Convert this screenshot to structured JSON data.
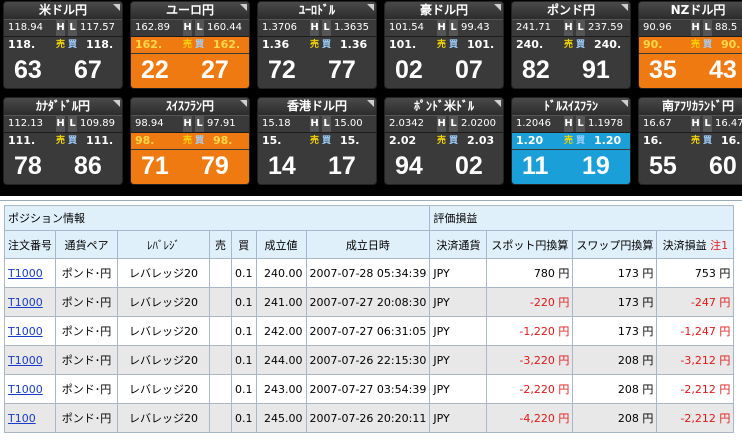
{
  "rates": [
    {
      "name": "米ドル円",
      "high": "118.94",
      "low": "117.57",
      "bid_prefix": "118.",
      "ask_prefix": "118.",
      "bid_big": "63",
      "ask_big": "67",
      "style": "dark"
    },
    {
      "name": "ユーロ円",
      "high": "162.89",
      "low": "160.44",
      "bid_prefix": "162.",
      "ask_prefix": "162.",
      "bid_big": "22",
      "ask_big": "27",
      "style": "orange"
    },
    {
      "name": "ﾕｰﾛﾄﾞﾙ",
      "high": "1.3706",
      "low": "1.3635",
      "bid_prefix": "1.36",
      "ask_prefix": "1.36",
      "bid_big": "72",
      "ask_big": "77",
      "style": "dark"
    },
    {
      "name": "豪ドル円",
      "high": "101.54",
      "low": "99.43",
      "bid_prefix": "101.",
      "ask_prefix": "101.",
      "bid_big": "02",
      "ask_big": "07",
      "style": "dark"
    },
    {
      "name": "ポンド円",
      "high": "241.71",
      "low": "237.59",
      "bid_prefix": "240.",
      "ask_prefix": "240.",
      "bid_big": "82",
      "ask_big": "91",
      "style": "dark"
    },
    {
      "name": "NZドル円",
      "high": "90.96",
      "low": "88.5",
      "bid_prefix": "90.",
      "ask_prefix": "90.",
      "bid_big": "35",
      "ask_big": "43",
      "style": "orange"
    },
    {
      "name": "ｶﾅﾀﾞﾄﾞﾙ円",
      "high": "112.13",
      "low": "109.89",
      "bid_prefix": "111.",
      "ask_prefix": "111.",
      "bid_big": "78",
      "ask_big": "86",
      "style": "dark"
    },
    {
      "name": "ｽｲｽﾌﾗﾝ円",
      "high": "98.94",
      "low": "97.91",
      "bid_prefix": "98.",
      "ask_prefix": "98.",
      "bid_big": "71",
      "ask_big": "79",
      "style": "orange"
    },
    {
      "name": "香港ドル円",
      "high": "15.18",
      "low": "15.00",
      "bid_prefix": "15.",
      "ask_prefix": "15.",
      "bid_big": "14",
      "ask_big": "17",
      "style": "dark"
    },
    {
      "name": "ﾎﾟﾝﾄﾞ米ﾄﾞﾙ",
      "high": "2.0342",
      "low": "2.0200",
      "bid_prefix": "2.02",
      "ask_prefix": "2.03",
      "bid_big": "94",
      "ask_big": "02",
      "style": "dark"
    },
    {
      "name": "ﾄﾞﾙｽｲｽﾌﾗﾝ",
      "high": "1.2046",
      "low": "1.1978",
      "bid_prefix": "1.20",
      "ask_prefix": "1.20",
      "bid_big": "11",
      "ask_big": "19",
      "style": "blue"
    },
    {
      "name": "南ｱﾌﾘｶﾗﾝﾄﾞ円",
      "high": "16.67",
      "low": "16.47",
      "bid_prefix": "16.",
      "ask_prefix": "16.",
      "bid_big": "55",
      "ask_big": "60",
      "style": "dark"
    }
  ],
  "tile_labels": {
    "h": "H",
    "l": "L",
    "sell": "売",
    "buy": "買"
  },
  "positions": {
    "section_left": "ポジション情報",
    "section_right": "評価損益",
    "headers": [
      "注文番号",
      "通貨ペア",
      "ﾚﾊﾞﾚｼﾞ",
      "売",
      "買",
      "成立値",
      "成立日時",
      "決済通貨",
      "スポット円換算",
      "スワップ円換算",
      "決済損益"
    ],
    "header_note": "注1",
    "rows": [
      {
        "order": "T1000",
        "pair": "ポンド･円",
        "leverage": "レバレッジ20",
        "sell": "",
        "buy": "0.1",
        "price": "240.00",
        "datetime": "2007-07-28 05:34:39",
        "currency": "JPY",
        "spot": "780 円",
        "swap": "173 円",
        "pnl": "753 円",
        "spot_neg": false,
        "pnl_neg": false
      },
      {
        "order": "T1000",
        "pair": "ポンド･円",
        "leverage": "レバレッジ20",
        "sell": "",
        "buy": "0.1",
        "price": "241.00",
        "datetime": "2007-07-27 20:08:30",
        "currency": "JPY",
        "spot": "-220 円",
        "swap": "173 円",
        "pnl": "-247 円",
        "spot_neg": true,
        "pnl_neg": true
      },
      {
        "order": "T1000",
        "pair": "ポンド･円",
        "leverage": "レバレッジ20",
        "sell": "",
        "buy": "0.1",
        "price": "242.00",
        "datetime": "2007-07-27 06:31:05",
        "currency": "JPY",
        "spot": "-1,220 円",
        "swap": "173 円",
        "pnl": "-1,247 円",
        "spot_neg": true,
        "pnl_neg": true
      },
      {
        "order": "T1000",
        "pair": "ポンド･円",
        "leverage": "レバレッジ20",
        "sell": "",
        "buy": "0.1",
        "price": "244.00",
        "datetime": "2007-07-26 22:15:30",
        "currency": "JPY",
        "spot": "-3,220 円",
        "swap": "208 円",
        "pnl": "-3,212 円",
        "spot_neg": true,
        "pnl_neg": true
      },
      {
        "order": "T1000",
        "pair": "ポンド･円",
        "leverage": "レバレッジ20",
        "sell": "",
        "buy": "0.1",
        "price": "243.00",
        "datetime": "2007-07-27 03:54:39",
        "currency": "JPY",
        "spot": "-2,220 円",
        "swap": "208 円",
        "pnl": "-2,212 円",
        "spot_neg": true,
        "pnl_neg": true
      },
      {
        "order": "T100",
        "pair": "ポンド･円",
        "leverage": "レバレッジ20",
        "sell": "",
        "buy": "0.1",
        "price": "245.00",
        "datetime": "2007-07-26 20:20:11",
        "currency": "JPY",
        "spot": "-4,220 円",
        "swap": "208 円",
        "pnl": "-2,212 円",
        "spot_neg": true,
        "pnl_neg": true
      }
    ]
  }
}
